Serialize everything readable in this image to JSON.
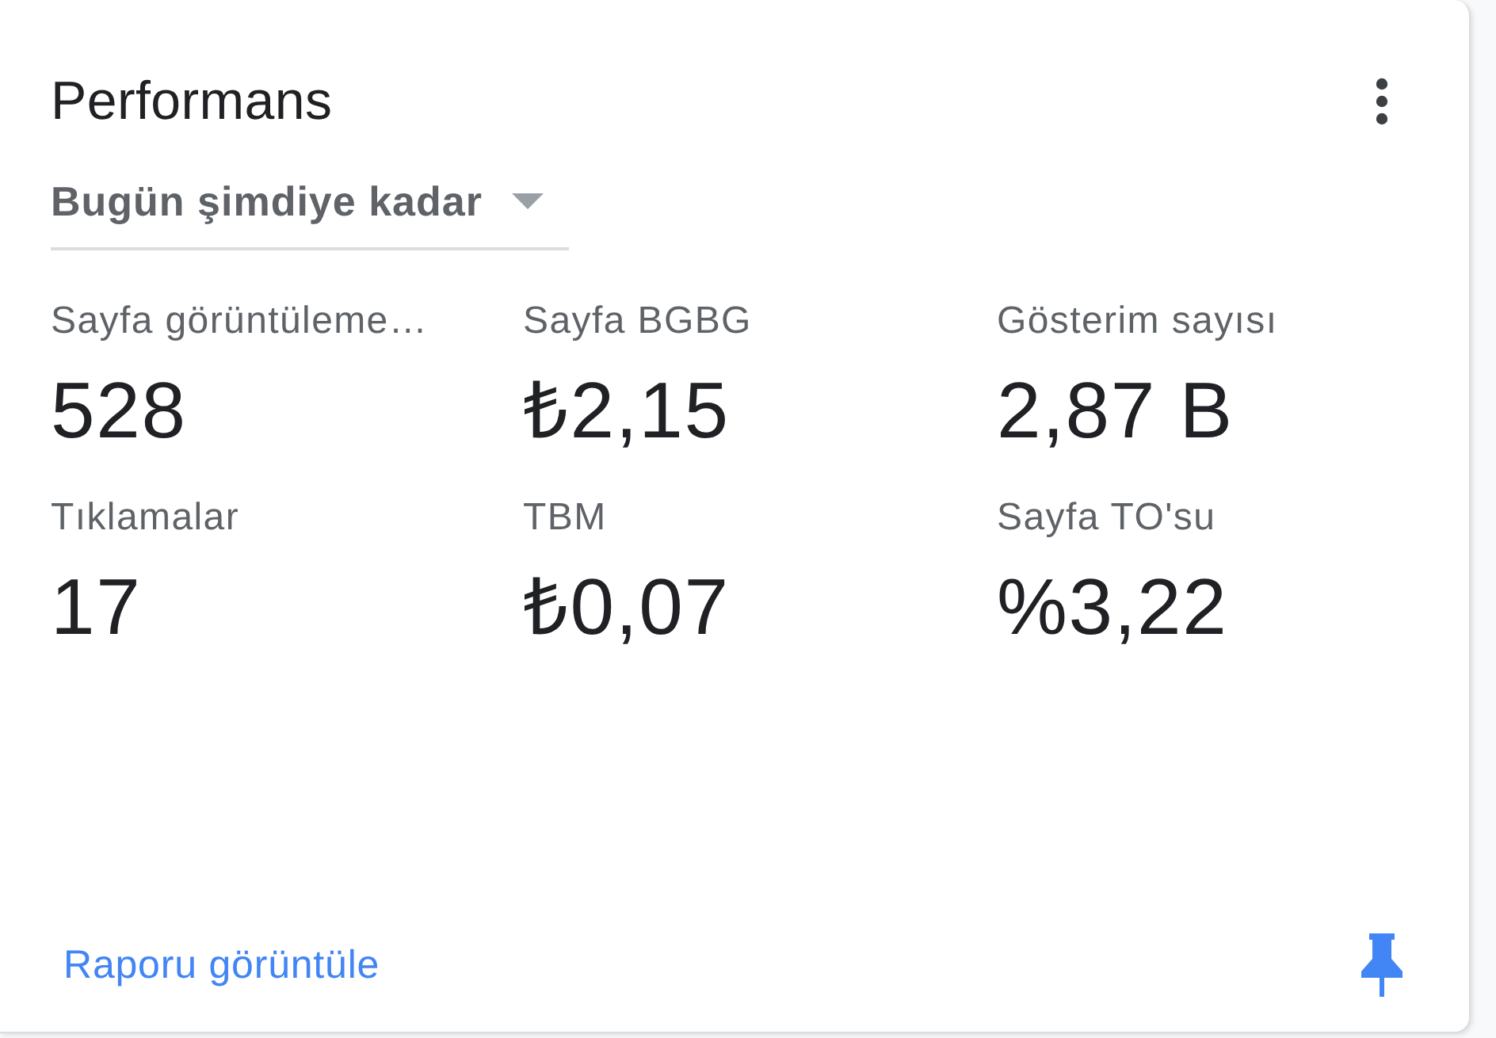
{
  "card": {
    "title": "Performans",
    "period_dropdown": {
      "value": "Bugün şimdiye kadar"
    },
    "metrics": [
      {
        "label": "Sayfa görüntüleme…",
        "value": "528"
      },
      {
        "label": "Sayfa BGBG",
        "value": "₺2,15"
      },
      {
        "label": "Gösterim sayısı",
        "value": "2,87 B"
      },
      {
        "label": "Tıklamalar",
        "value": "17"
      },
      {
        "label": "TBM",
        "value": "₺0,07"
      },
      {
        "label": "Sayfa TO'su",
        "value": "%3,22"
      }
    ],
    "report_link": "Raporu görüntüle"
  }
}
